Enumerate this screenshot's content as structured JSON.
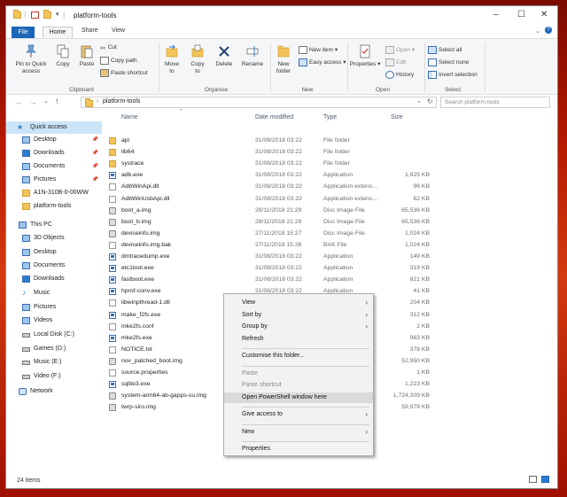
{
  "window": {
    "title": "platform-tools"
  },
  "tabs": [
    {
      "label": "File"
    },
    {
      "label": "Home"
    },
    {
      "label": "Share"
    },
    {
      "label": "View"
    }
  ],
  "ribbon": {
    "clipboard": {
      "pin": "Pin to Quick\naccess",
      "copy": "Copy",
      "paste": "Paste",
      "cut": "Cut",
      "copy_path": "Copy path",
      "paste_shortcut": "Paste shortcut",
      "group": "Clipboard"
    },
    "organise": {
      "move": "Move\nto",
      "copy": "Copy\nto",
      "delete": "Delete",
      "rename": "Rename",
      "group": "Organise"
    },
    "new": {
      "folder": "New\nfolder",
      "new_item": "New item",
      "easy_access": "Easy access",
      "group": "New"
    },
    "open": {
      "properties": "Properties",
      "open": "Open",
      "edit": "Edit",
      "history": "History",
      "group": "Open"
    },
    "select": {
      "all": "Select all",
      "none": "Select none",
      "invert": "Invert selection",
      "group": "Select"
    }
  },
  "address": {
    "path": "platform-tools",
    "search_placeholder": "Search platform-tools"
  },
  "nav": {
    "quick_access": "Quick access",
    "items": [
      {
        "label": "Desktop",
        "pinned": true
      },
      {
        "label": "Downloads",
        "pinned": true
      },
      {
        "label": "Documents",
        "pinned": true
      },
      {
        "label": "Pictures",
        "pinned": true
      },
      {
        "label": "A1N-310B-0-00WW"
      },
      {
        "label": "platform-tools"
      }
    ],
    "this_pc": "This PC",
    "pc_items": [
      {
        "label": "3D Objects"
      },
      {
        "label": "Desktop"
      },
      {
        "label": "Documents"
      },
      {
        "label": "Downloads"
      },
      {
        "label": "Music"
      },
      {
        "label": "Pictures"
      },
      {
        "label": "Videos"
      },
      {
        "label": "Local Disk (C:)"
      },
      {
        "label": "Games (D:)"
      },
      {
        "label": "Music (E:)"
      },
      {
        "label": "Video (F:)"
      }
    ],
    "network": "Network"
  },
  "columns": {
    "name": "Name",
    "date": "Date modified",
    "type": "Type",
    "size": "Size"
  },
  "files": [
    {
      "name": "api",
      "date": "31/08/2018 03:22",
      "type": "File folder",
      "size": "",
      "icon": "folder"
    },
    {
      "name": "lib64",
      "date": "31/08/2018 03:22",
      "type": "File folder",
      "size": "",
      "icon": "folder"
    },
    {
      "name": "systrace",
      "date": "31/08/2018 03:22",
      "type": "File folder",
      "size": "",
      "icon": "folder"
    },
    {
      "name": "adb.exe",
      "date": "31/08/2018 03:22",
      "type": "Application",
      "size": "1,825 KB",
      "icon": "app"
    },
    {
      "name": "AdbWinApi.dll",
      "date": "31/08/2018 03:22",
      "type": "Application extens...",
      "size": "96 KB",
      "icon": "doc"
    },
    {
      "name": "AdbWinUsbApi.dll",
      "date": "31/08/2018 03:22",
      "type": "Application extens...",
      "size": "62 KB",
      "icon": "doc"
    },
    {
      "name": "boot_a.img",
      "date": "28/11/2018 21:29",
      "type": "Disc Image File",
      "size": "65,536 KB",
      "icon": "disc"
    },
    {
      "name": "boot_b.img",
      "date": "28/11/2018 21:29",
      "type": "Disc Image File",
      "size": "65,536 KB",
      "icon": "disc"
    },
    {
      "name": "deviceinfo.img",
      "date": "27/11/2018 15:27",
      "type": "Disc Image File",
      "size": "1,024 KB",
      "icon": "disc"
    },
    {
      "name": "deviceinfo.img.bak",
      "date": "27/11/2018 15:26",
      "type": "BAK File",
      "size": "1,024 KB",
      "icon": "doc"
    },
    {
      "name": "dmtracedump.exe",
      "date": "31/08/2018 03:22",
      "type": "Application",
      "size": "149 KB",
      "icon": "app"
    },
    {
      "name": "etc1tool.exe",
      "date": "31/08/2018 03:22",
      "type": "Application",
      "size": "319 KB",
      "icon": "app"
    },
    {
      "name": "fastboot.exe",
      "date": "31/08/2018 03:22",
      "type": "Application",
      "size": "821 KB",
      "icon": "app"
    },
    {
      "name": "hprof-conv.exe",
      "date": "31/08/2018 03:22",
      "type": "Application",
      "size": "41 KB",
      "icon": "app"
    },
    {
      "name": "libwinpthread-1.dll",
      "date": "",
      "type": "",
      "size": "204 KB",
      "icon": "doc"
    },
    {
      "name": "make_f2fs.exe",
      "date": "",
      "type": "",
      "size": "312 KB",
      "icon": "app"
    },
    {
      "name": "mke2fs.conf",
      "date": "",
      "type": "",
      "size": "2 KB",
      "icon": "doc"
    },
    {
      "name": "mke2fs.exe",
      "date": "",
      "type": "",
      "size": "963 KB",
      "icon": "app"
    },
    {
      "name": "NOTICE.txt",
      "date": "",
      "type": "",
      "size": "378 KB",
      "icon": "doc"
    },
    {
      "name": "nov_patched_boot.img",
      "date": "",
      "type": "",
      "size": "52,950 KB",
      "icon": "disc"
    },
    {
      "name": "source.properties",
      "date": "",
      "type": "",
      "size": "1 KB",
      "icon": "doc"
    },
    {
      "name": "sqlite3.exe",
      "date": "",
      "type": "",
      "size": "1,223 KB",
      "icon": "app"
    },
    {
      "name": "system-arm64-ab-gapps-su.img",
      "date": "",
      "type": "",
      "size": "1,724,309 KB",
      "icon": "disc"
    },
    {
      "name": "twrp-siro.img",
      "date": "",
      "type": "",
      "size": "59,978 KB",
      "icon": "disc"
    }
  ],
  "status": {
    "count": "24 items"
  },
  "context_menu": [
    {
      "label": "View",
      "sub": true
    },
    {
      "label": "Sort by",
      "sub": true
    },
    {
      "label": "Group by",
      "sub": true
    },
    {
      "label": "Refresh"
    },
    {
      "sep": true
    },
    {
      "label": "Customise this folder..."
    },
    {
      "sep": true
    },
    {
      "label": "Paste",
      "disabled": true
    },
    {
      "label": "Paste shortcut",
      "disabled": true
    },
    {
      "label": "Open PowerShell window here",
      "highlight": true
    },
    {
      "sep": true
    },
    {
      "label": "Give access to",
      "sub": true
    },
    {
      "sep": true
    },
    {
      "label": "New",
      "sub": true
    },
    {
      "sep": true
    },
    {
      "label": "Properties"
    }
  ]
}
